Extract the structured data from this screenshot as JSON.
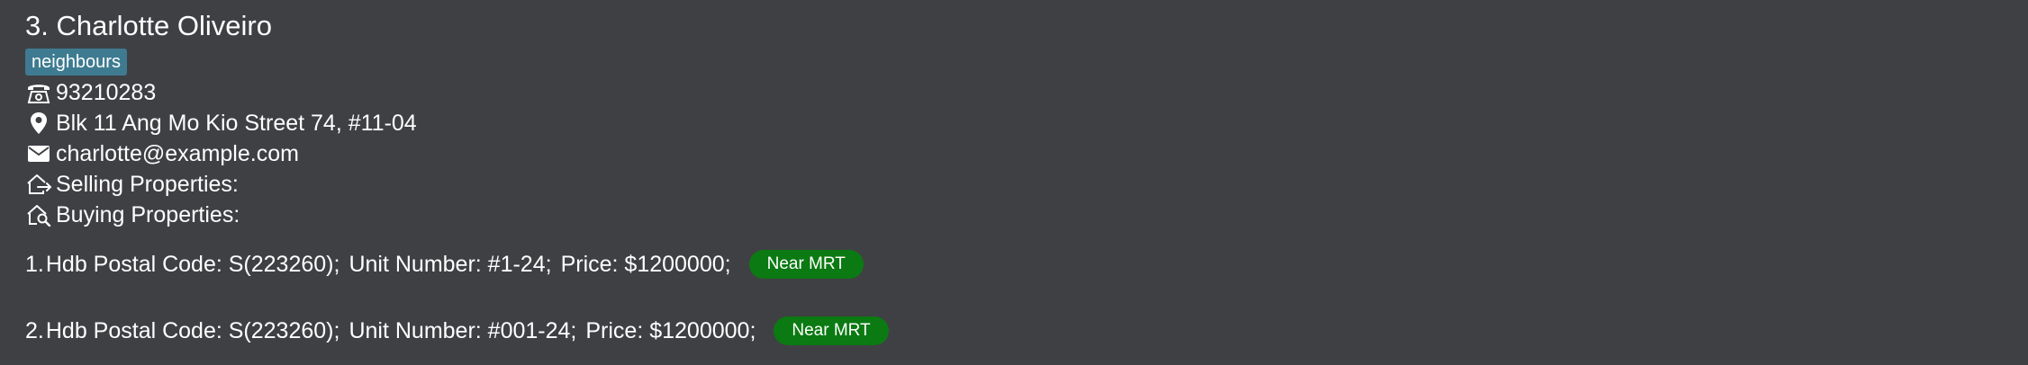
{
  "person": {
    "name": "3. Charlotte Oliveiro",
    "tags": [
      "neighbours"
    ],
    "phone": "93210283",
    "address": "Blk 11 Ang Mo Kio Street 74, #11-04",
    "email": "charlotte@example.com",
    "selling_label": "Selling Properties:",
    "buying_label": "Buying Properties:"
  },
  "icons": {
    "phone": "phone-icon",
    "address": "location-pin-icon",
    "email": "envelope-icon",
    "selling": "house-arrow-out-icon",
    "buying": "house-search-icon"
  },
  "listings": [
    {
      "index": "1.",
      "postal": "Hdb Postal Code: S(223260);",
      "unit": "Unit Number: #1-24;",
      "price": "Price: $1200000;",
      "tag": "Near MRT"
    },
    {
      "index": "2.",
      "postal": "Hdb Postal Code: S(223260);",
      "unit": "Unit Number: #001-24;",
      "price": "Price: $1200000;",
      "tag": "Near MRT"
    }
  ],
  "colors": {
    "background": "#3f4044",
    "tag": "#3e7b91",
    "badge": "#0b7a12",
    "text": "#ffffff"
  }
}
